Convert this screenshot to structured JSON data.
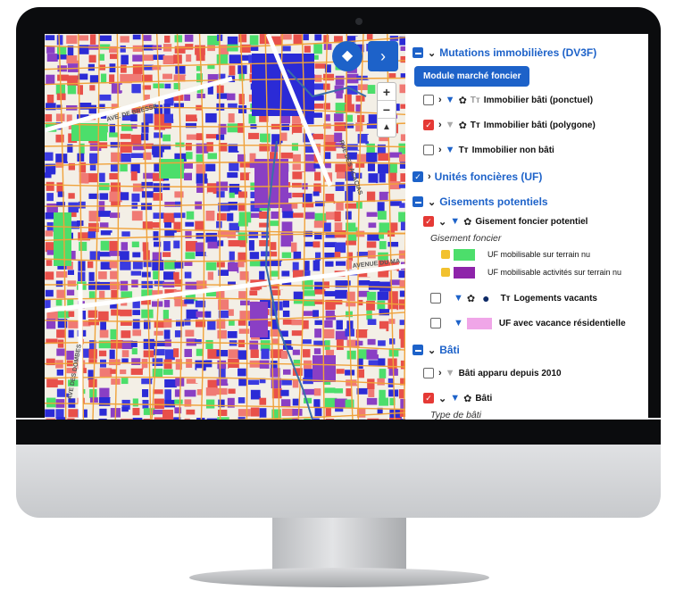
{
  "map": {
    "street_labels": [
      "AVE. DE BRESSE",
      "AVENUE DU MA",
      "AVE DES DOMBES",
      "RUE DES ACACIAS"
    ],
    "zoom_in": "+",
    "zoom_out": "−",
    "compass": "▲",
    "layers_icon": "◆",
    "panel_toggle_icon": "›"
  },
  "panel": {
    "sections": {
      "dv3f": {
        "title": "Mutations immobilières (DV3F)",
        "button": "Module marché foncier",
        "items": [
          {
            "label": "Immobilier bâti (ponctuel)"
          },
          {
            "label": "Immobilier bâti (polygone)"
          },
          {
            "label": "Immobilier non bâti"
          }
        ]
      },
      "uf": {
        "title": "Unités foncières (UF)"
      },
      "gisements": {
        "title": "Gisements potentiels",
        "item": "Gisement foncier potentiel",
        "subtitle": "Gisement foncier",
        "legend": [
          {
            "label": "UF mobilisable sur terrain nu",
            "color": "#4cde6b"
          },
          {
            "label": "UF mobilisable activités sur terrain nu",
            "color": "#8e24aa"
          }
        ],
        "vacants": "Logements vacants",
        "vacance": "UF avec vacance résidentielle",
        "vacance_color": "#f0a6e8"
      },
      "bati": {
        "title": "Bâti",
        "item1": "Bâti apparu depuis 2010",
        "item2": "Bâti",
        "subtitle": "Type de bâti"
      }
    }
  },
  "colors": {
    "accent": "#1d62c9",
    "checked_red": "#e53935",
    "bati_blue": "#2b2bd6",
    "parcel_red": "#e8504a",
    "road_orange": "#f0a23a"
  }
}
